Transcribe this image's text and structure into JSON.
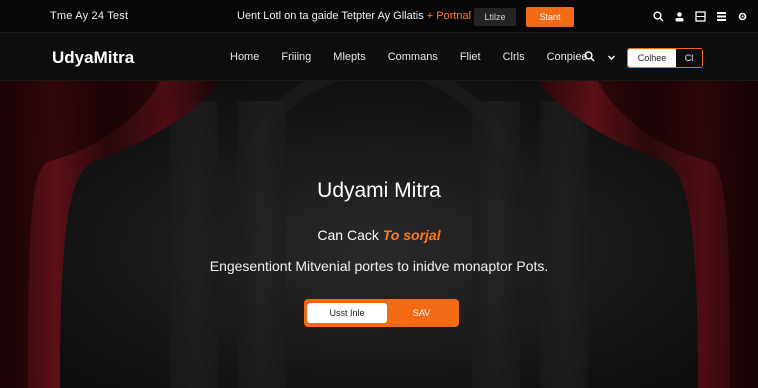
{
  "topbar": {
    "left_text": "Tme Ay 24 Test",
    "center_text": "Uent Lotl on ta gaide Tetpter Ay Gllatis",
    "center_accent": "+ Portnal",
    "small_button": "Ltilze",
    "cta_button": "Stant",
    "icons": [
      "search-icon",
      "user-icon",
      "grid-icon",
      "menu-icon",
      "settings-icon"
    ]
  },
  "nav": {
    "brand": "UdyaMitra",
    "items": [
      "Home",
      "Friiing",
      "Mlepts",
      "Commans",
      "Fliet",
      "Clrls",
      "Conpiee"
    ],
    "pill_left": "Colhee",
    "pill_right": "Cl"
  },
  "hero": {
    "title": "Udyami Mitra",
    "subtitle_prefix": "Can Cack",
    "subtitle_accent": "To sorjal",
    "description": "Engesentiont Mitvenial portes to inidve monaptor Pots.",
    "button_primary": "Usst Inle",
    "button_secondary": "SAV"
  },
  "colors": {
    "accent": "#f26a14",
    "background": "#0b0b0c",
    "curtain": "#5a0f18"
  }
}
